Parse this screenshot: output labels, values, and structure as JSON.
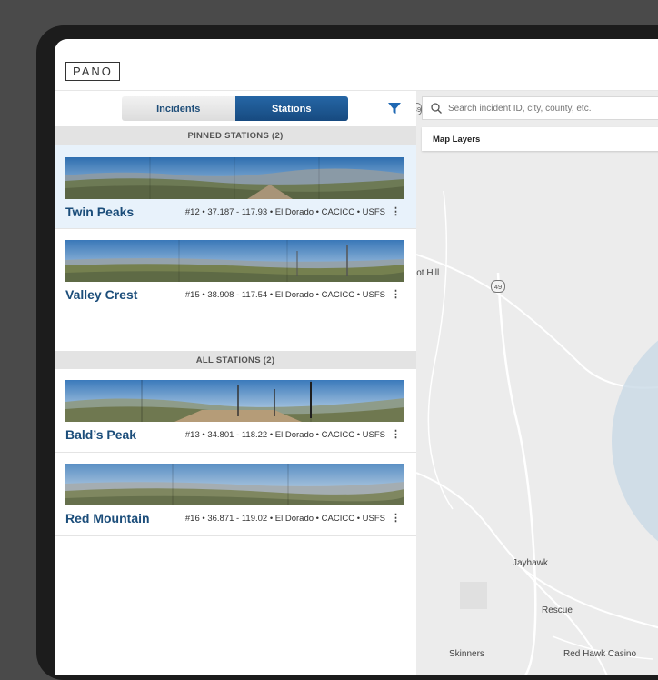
{
  "app": {
    "logo": "PANO"
  },
  "tabs": {
    "incidents": "Incidents",
    "stations": "Stations",
    "active": "stations"
  },
  "sections": {
    "pinned": "PINNED STATIONS (2)",
    "all": "ALL STATIONS (2)"
  },
  "pinned_stations": [
    {
      "name": "Twin Peaks",
      "meta": "#12 • 37.187 - 117.93 • El Dorado • CACICC • USFS"
    },
    {
      "name": "Valley Crest",
      "meta": "#15 • 38.908 - 117.54 • El Dorado • CACICC • USFS"
    }
  ],
  "all_stations": [
    {
      "name": "Bald’s Peak",
      "meta": "#13 • 34.801 - 118.22 • El Dorado • CACICC • USFS"
    },
    {
      "name": "Red Mountain",
      "meta": "#16 • 36.871 - 119.02 • El Dorado • CACICC • USFS"
    }
  ],
  "map": {
    "search_placeholder": "Search incident ID, city, county, etc.",
    "layers_label": "Map Layers",
    "route_label": "49",
    "edge_route_label": "49",
    "places": [
      "lot Hill",
      "Jayhawk",
      "Rescue",
      "Skinners",
      "Red Hawk Casino"
    ]
  },
  "colors": {
    "primary": "#1b4d7a",
    "active_tab": "#1f5b99",
    "highlight": "#e8f2fb"
  }
}
